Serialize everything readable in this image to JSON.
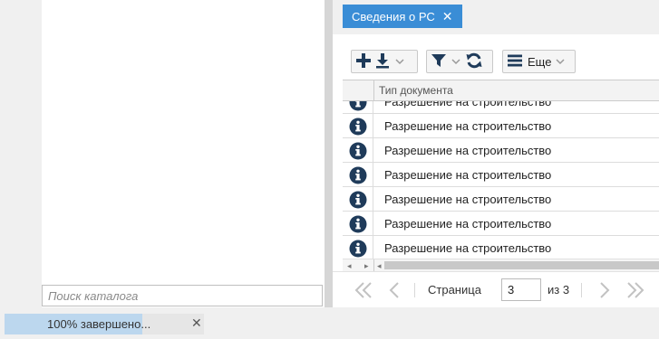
{
  "catalog": {
    "search_placeholder": "Поиск каталога"
  },
  "tab": {
    "label": "Сведения о РС",
    "close_glyph": "✕"
  },
  "toolbar": {
    "more_label": "Еще"
  },
  "grid": {
    "column_header": "Тип документа",
    "rows": [
      "Разрешение на строительство",
      "Разрешение на строительство",
      "Разрешение на строительство",
      "Разрешение на строительство",
      "Разрешение на строительство",
      "Разрешение на строительство",
      "Разрешение на строительство"
    ],
    "row_icon": "info-circle-icon"
  },
  "pager": {
    "page_label": "Страница",
    "current_page": "3",
    "of_label": "из 3"
  },
  "progress": {
    "text": "100% завершено...",
    "value": 1.0,
    "close_glyph": "✕"
  },
  "colors": {
    "accent": "#3a8dd6",
    "icon": "#1f3b5a",
    "progress_fill": "#bcd7ee"
  }
}
